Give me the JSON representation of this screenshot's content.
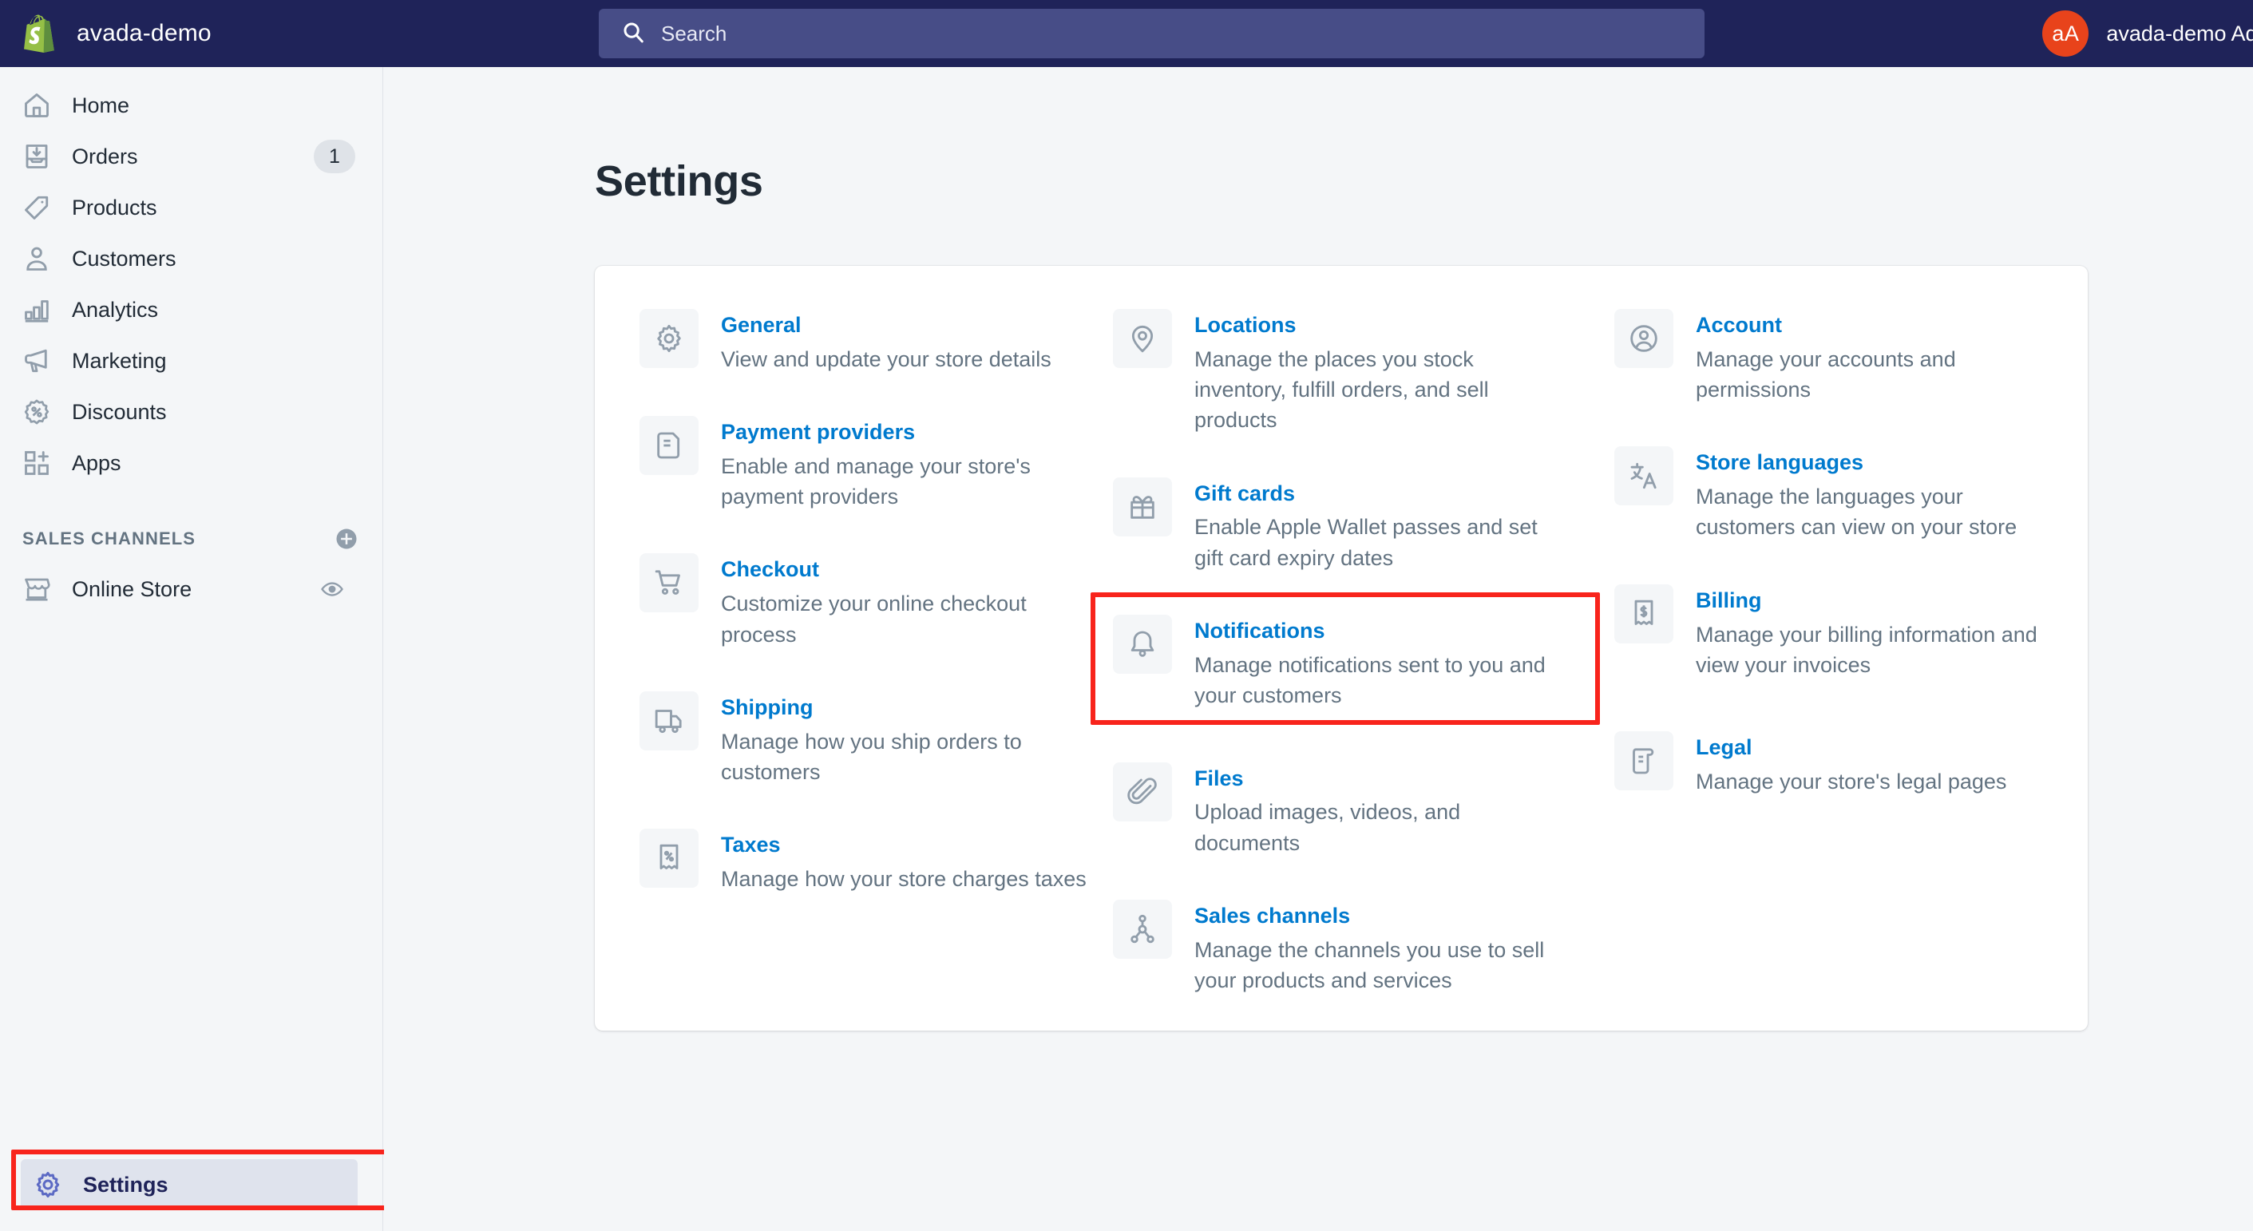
{
  "topbar": {
    "brand_name": "avada-demo",
    "search_placeholder": "Search",
    "search_value": "",
    "avatar_initials": "aA",
    "account_name": "avada-demo Adm"
  },
  "sidebar": {
    "items": [
      {
        "label": "Home",
        "icon": "home-icon",
        "badge": ""
      },
      {
        "label": "Orders",
        "icon": "orders-icon",
        "badge": "1"
      },
      {
        "label": "Products",
        "icon": "products-tag-icon",
        "badge": ""
      },
      {
        "label": "Customers",
        "icon": "customers-person-icon",
        "badge": ""
      },
      {
        "label": "Analytics",
        "icon": "analytics-bars-icon",
        "badge": ""
      },
      {
        "label": "Marketing",
        "icon": "marketing-megaphone-icon",
        "badge": ""
      },
      {
        "label": "Discounts",
        "icon": "discounts-percent-icon",
        "badge": ""
      },
      {
        "label": "Apps",
        "icon": "apps-grid-plus-icon",
        "badge": ""
      }
    ],
    "sales_channels": {
      "title": "SALES CHANNELS",
      "add_icon": "plus-circle-icon",
      "items": [
        {
          "label": "Online Store",
          "icon": "online-store-icon",
          "action_icon": "eye-icon"
        }
      ]
    },
    "settings": {
      "label": "Settings",
      "icon": "gear-icon"
    }
  },
  "main": {
    "page_title": "Settings",
    "settings_items": [
      {
        "link": "General",
        "desc": "View and update your store details",
        "icon": "gear-icon",
        "highlighted": false
      },
      {
        "link": "Locations",
        "desc": "Manage the places you stock inventory, fulfill orders, and sell products",
        "icon": "location-pin-icon",
        "highlighted": false
      },
      {
        "link": "Account",
        "desc": "Manage your accounts and permissions",
        "icon": "account-circle-icon",
        "highlighted": false
      },
      {
        "link": "Payment providers",
        "desc": "Enable and manage your store's payment providers",
        "icon": "payment-card-icon",
        "highlighted": false
      },
      {
        "link": "Gift cards",
        "desc": "Enable Apple Wallet passes and set gift card expiry dates",
        "icon": "gift-icon",
        "highlighted": false
      },
      {
        "link": "Store languages",
        "desc": "Manage the languages your customers can view on your store",
        "icon": "translate-icon",
        "highlighted": false
      },
      {
        "link": "Checkout",
        "desc": "Customize your online checkout process",
        "icon": "shopping-cart-icon",
        "highlighted": false
      },
      {
        "link": "Notifications",
        "desc": "Manage notifications sent to you and your customers",
        "icon": "bell-icon",
        "highlighted": true
      },
      {
        "link": "Billing",
        "desc": "Manage your billing information and view your invoices",
        "icon": "receipt-dollar-icon",
        "highlighted": false
      },
      {
        "link": "Shipping",
        "desc": "Manage how you ship orders to customers",
        "icon": "truck-icon",
        "highlighted": false
      },
      {
        "link": "Files",
        "desc": "Upload images, videos, and documents",
        "icon": "paperclip-icon",
        "highlighted": false
      },
      {
        "link": "Legal",
        "desc": "Manage your store's legal pages",
        "icon": "legal-scroll-icon",
        "highlighted": false
      },
      {
        "link": "Taxes",
        "desc": "Manage how your store charges taxes",
        "icon": "receipt-percent-icon",
        "highlighted": false
      },
      {
        "link": "Sales channels",
        "desc": "Manage the channels you use to sell your products and services",
        "icon": "sales-channels-node-icon",
        "highlighted": false
      }
    ]
  },
  "colors": {
    "topbar_bg": "#1f2359",
    "link_blue": "#007ace",
    "annotation_red": "#f8241c",
    "avatar_orange": "#e8431b",
    "page_bg": "#f4f6f8"
  }
}
